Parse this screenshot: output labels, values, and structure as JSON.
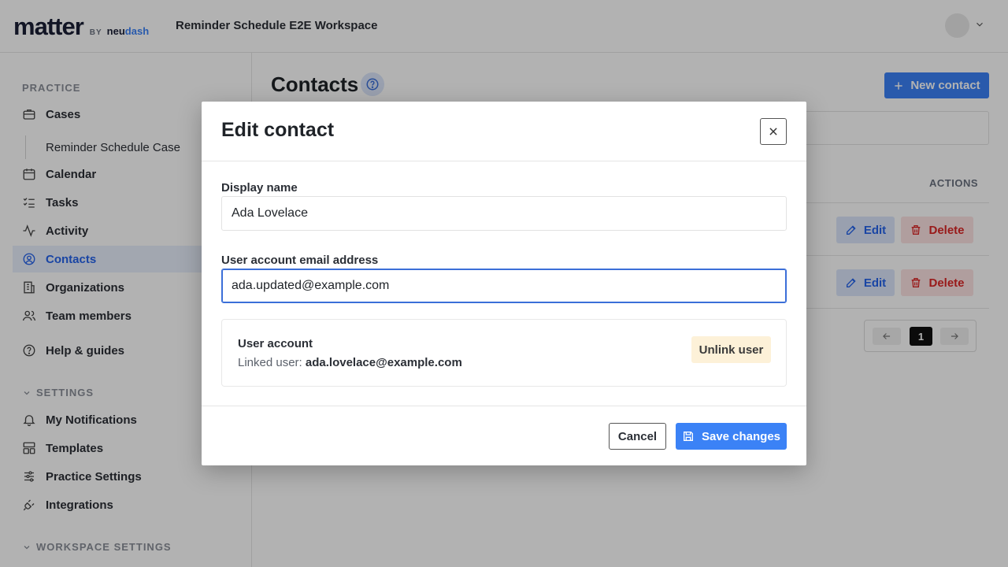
{
  "header": {
    "logo_main": "matter",
    "logo_by": "BY",
    "logo_brand_1": "neu",
    "logo_brand_2": "dash",
    "workspace_name": "Reminder Schedule E2E Workspace"
  },
  "sidebar": {
    "practice_label": "PRACTICE",
    "items": [
      {
        "label": "Cases",
        "icon": "briefcase-icon"
      },
      {
        "label": "Reminder Schedule Case",
        "icon": ""
      },
      {
        "label": "Calendar",
        "icon": "calendar-icon"
      },
      {
        "label": "Tasks",
        "icon": "tasks-icon"
      },
      {
        "label": "Activity",
        "icon": "activity-icon"
      },
      {
        "label": "Contacts",
        "icon": "contacts-icon"
      },
      {
        "label": "Organizations",
        "icon": "building-icon"
      },
      {
        "label": "Team members",
        "icon": "team-icon"
      },
      {
        "label": "Help & guides",
        "icon": "help-icon"
      }
    ],
    "settings_label": "SETTINGS",
    "settings_items": [
      {
        "label": "My Notifications",
        "icon": "bell-icon"
      },
      {
        "label": "Templates",
        "icon": "templates-icon"
      },
      {
        "label": "Practice Settings",
        "icon": "sliders-icon"
      },
      {
        "label": "Integrations",
        "icon": "plug-icon"
      }
    ],
    "workspace_settings_label": "WORKSPACE SETTINGS"
  },
  "main": {
    "title": "Contacts",
    "new_contact_label": "New contact",
    "actions_header": "ACTIONS",
    "row_actions": {
      "edit": "Edit",
      "delete": "Delete"
    },
    "pagination": {
      "current_page": "1"
    }
  },
  "modal": {
    "title": "Edit contact",
    "display_name_label": "Display name",
    "display_name_value": "Ada Lovelace",
    "email_label": "User account email address",
    "email_value": "ada.updated@example.com",
    "account_title": "User account",
    "linked_user_prefix": "Linked user:",
    "linked_user_email": "ada.lovelace@example.com",
    "unlink_label": "Unlink user",
    "cancel_label": "Cancel",
    "save_label": "Save changes"
  },
  "colors": {
    "primary": "#3b82f6",
    "active_nav_bg": "#e8effd",
    "danger": "#dc2626",
    "warning_bg": "#fdf1d8"
  }
}
